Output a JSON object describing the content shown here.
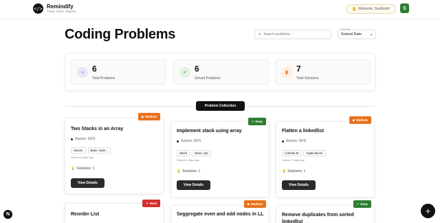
{
  "header": {
    "brand": "Remindify",
    "tagline": "Track. Solve. Repeat.",
    "logo_icon": "</>",
    "welcome": "Welcome, Santhosh!",
    "avatar_letter": "S"
  },
  "main": {
    "title": "Coding Problems",
    "search_placeholder": "Search problems...",
    "sort_label": "Sort By",
    "sort_value": "Solved Date"
  },
  "stats": [
    {
      "value": "6",
      "label": "Total Problems",
      "icon": "code-icon",
      "glyph": "‹›",
      "color": "#4a5bd4",
      "bg": "#e6e9f8"
    },
    {
      "value": "6",
      "label": "Solved Problems",
      "icon": "check-circle-icon",
      "glyph": "✓",
      "color": "#2e7d32",
      "bg": "#e3f2e4"
    },
    {
      "value": "7",
      "label": "Total Solutions",
      "icon": "bar-chart-icon",
      "glyph": "▮",
      "color": "#e8711c",
      "bg": "#fdeee0"
    }
  ],
  "collection_label": "Problem Collection",
  "cards": [
    {
      "title": "Two Stacks in an Array",
      "difficulty": "Medium",
      "source": "Source: GFG",
      "tags": [
        "Stacks",
        "Basic Oper..."
      ],
      "solved": "Solved 0 days ago",
      "solutions": "Solutions: 1",
      "button": "View Details"
    },
    {
      "title": "Implement stack using array",
      "difficulty": "Easy",
      "source": "Source: GFG",
      "tags": [
        "Stack",
        "Basic ops"
      ],
      "solved": "Solved 4 days ago",
      "solutions": "Solutions: 1",
      "button": "View Details"
    },
    {
      "title": "Flatten a linkedlist",
      "difficulty": "Medium",
      "source": "Source: GFG",
      "tags": [
        "LinkedList",
        "Applications"
      ],
      "solved": "Solved 7 days ago",
      "solutions": "Solutions: 1",
      "button": "View Details"
    },
    {
      "title": "Reorder List",
      "difficulty": "Hard"
    },
    {
      "title": "Seggregate even and odd nodes in LL",
      "difficulty": "Medium"
    },
    {
      "title": "Remove duplicates from sorted linkedlist",
      "difficulty": "Easy"
    }
  ],
  "floating": {
    "n_logo": "N",
    "fab": "+"
  }
}
